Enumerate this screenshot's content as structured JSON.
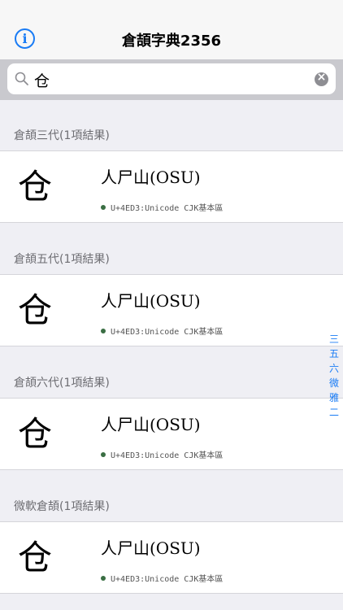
{
  "nav": {
    "title": "倉頡字典2356",
    "info_icon": "info-icon",
    "info_glyph": "i"
  },
  "search": {
    "value": "仓",
    "icon": "search-icon",
    "clear_icon": "clear-icon",
    "clear_glyph": "×"
  },
  "sections": [
    {
      "header": "倉頡三代(1項結果)",
      "glyph": "仓",
      "code": "人尸山(OSU)",
      "info": "U+4ED3:Unicode CJK基本區"
    },
    {
      "header": "倉頡五代(1項結果)",
      "glyph": "仓",
      "code": "人尸山(OSU)",
      "info": "U+4ED3:Unicode CJK基本區"
    },
    {
      "header": "倉頡六代(1項結果)",
      "glyph": "仓",
      "code": "人尸山(OSU)",
      "info": "U+4ED3:Unicode CJK基本區"
    },
    {
      "header": "微軟倉頡(1項結果)",
      "glyph": "仓",
      "code": "人尸山(OSU)",
      "info": "U+4ED3:Unicode CJK基本區"
    }
  ],
  "section_index": [
    "三",
    "五",
    "六",
    "微",
    "雅",
    "二"
  ],
  "colors": {
    "accent": "#1a7cf5",
    "dot": "#3a6e43"
  }
}
